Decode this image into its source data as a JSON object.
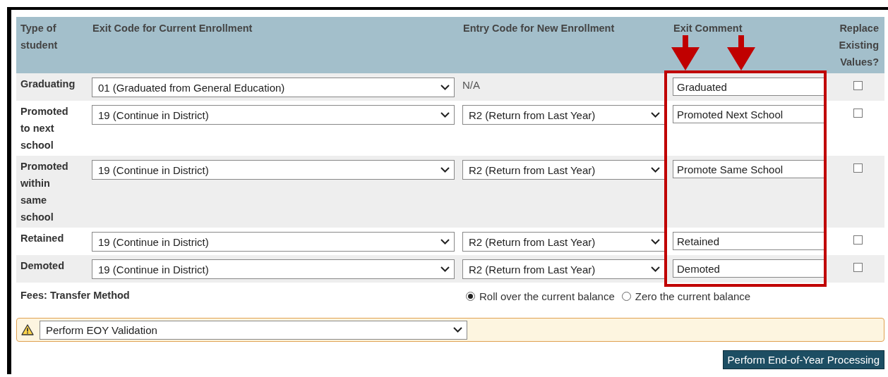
{
  "table": {
    "columns": [
      "Type of student",
      "Exit Code for Current Enrollment",
      "Entry Code for New Enrollment",
      "Exit Comment",
      "Replace Existing Values?"
    ],
    "rows": [
      {
        "type": "Graduating",
        "exit_code": "01 (Graduated from General Education)",
        "entry_code": {
          "kind": "text",
          "value": "N/A"
        },
        "comment": "Graduated",
        "replace": false
      },
      {
        "type": "Promoted to next school",
        "exit_code": "19 (Continue in District)",
        "entry_code": {
          "kind": "select",
          "value": "R2 (Return from Last Year)"
        },
        "comment": "Promoted Next School",
        "replace": false
      },
      {
        "type": "Promoted within same school",
        "exit_code": "19 (Continue in District)",
        "entry_code": {
          "kind": "select",
          "value": "R2 (Return from Last Year)"
        },
        "comment": "Promote Same School",
        "replace": false
      },
      {
        "type": "Retained",
        "exit_code": "19 (Continue in District)",
        "entry_code": {
          "kind": "select",
          "value": "R2 (Return from Last Year)"
        },
        "comment": "Retained",
        "replace": false
      },
      {
        "type": "Demoted",
        "exit_code": "19 (Continue in District)",
        "entry_code": {
          "kind": "select",
          "value": "R2 (Return from Last Year)"
        },
        "comment": "Demoted",
        "replace": false
      }
    ]
  },
  "fees": {
    "label": "Fees: Transfer Method",
    "options": [
      {
        "label": "Roll over the current balance",
        "selected": true
      },
      {
        "label": "Zero the current balance",
        "selected": false
      }
    ]
  },
  "validation": {
    "value": "Perform EOY Validation"
  },
  "button": "Perform End-of-Year Processing"
}
